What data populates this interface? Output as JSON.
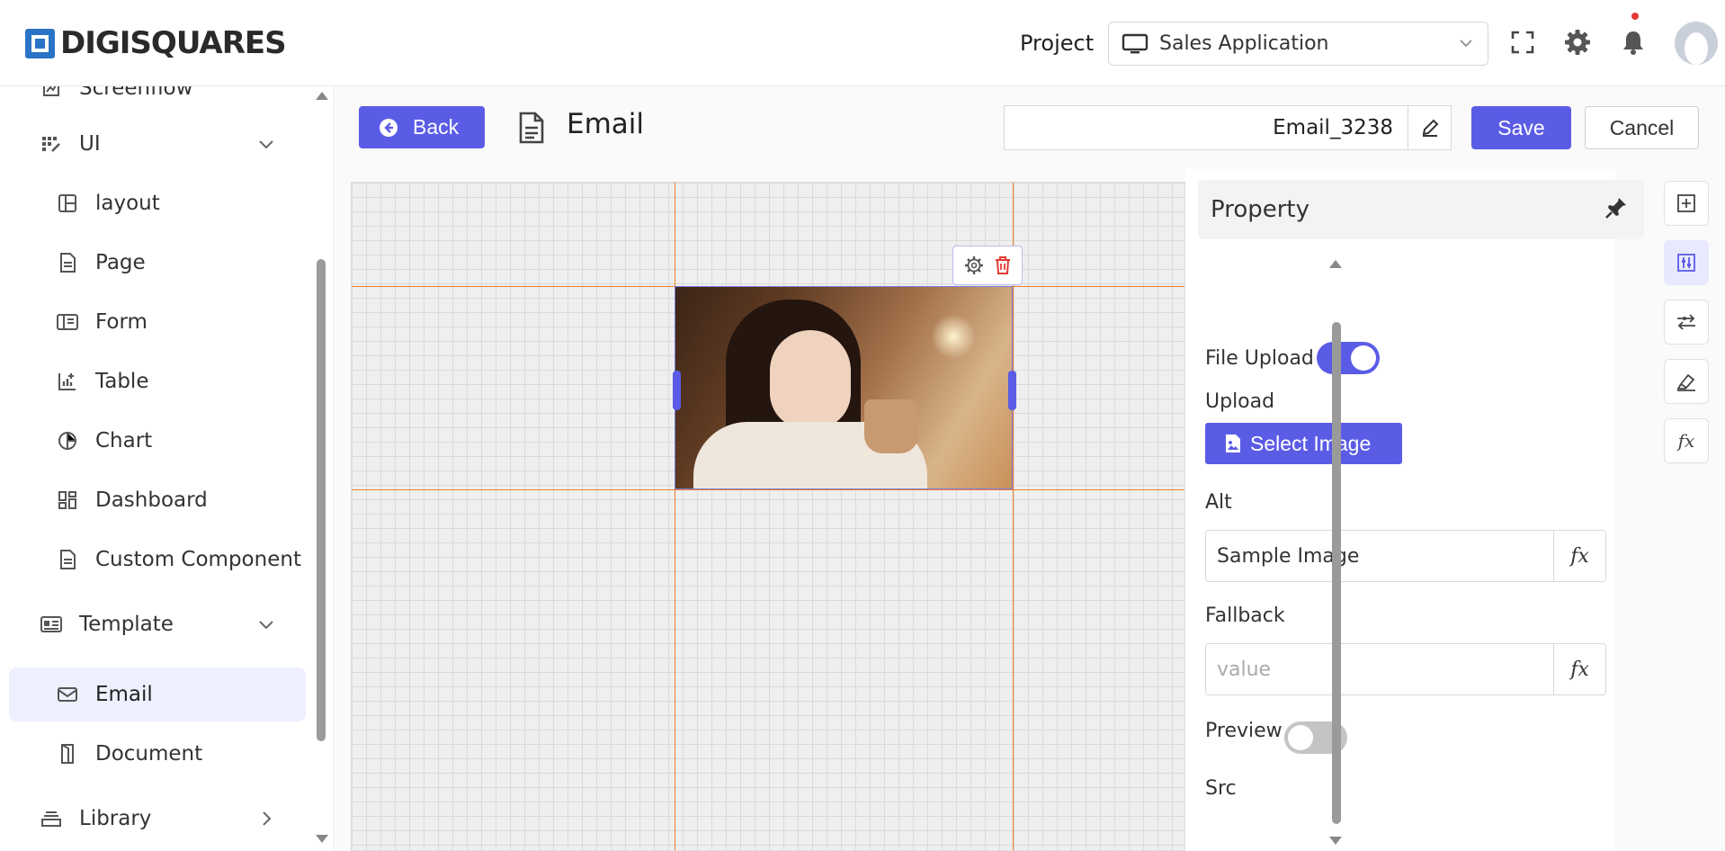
{
  "header": {
    "logo_text": "DIGISQUARES",
    "project_label": "Project",
    "project_value": "Sales Application",
    "icons": [
      "monitor-icon",
      "chevron-down-icon",
      "fullscreen-icon",
      "gear-icon",
      "bell-icon",
      "avatar"
    ]
  },
  "sidebar": {
    "items": [
      {
        "label": "Screenflow",
        "icon": "screenflow-icon",
        "level": 1
      },
      {
        "label": "UI",
        "icon": "ui-icon",
        "level": 1,
        "caret": "down"
      },
      {
        "label": "layout",
        "icon": "layout-icon",
        "level": 2
      },
      {
        "label": "Page",
        "icon": "page-icon",
        "level": 2
      },
      {
        "label": "Form",
        "icon": "form-icon",
        "level": 2
      },
      {
        "label": "Table",
        "icon": "table-icon",
        "level": 2
      },
      {
        "label": "Chart",
        "icon": "chart-icon",
        "level": 2
      },
      {
        "label": "Dashboard",
        "icon": "dashboard-icon",
        "level": 2
      },
      {
        "label": "Custom Component",
        "icon": "custom-component-icon",
        "level": 2
      },
      {
        "label": "Template",
        "icon": "template-icon",
        "level": 1,
        "caret": "down"
      },
      {
        "label": "Email",
        "icon": "mail-icon",
        "level": 2,
        "active": true
      },
      {
        "label": "Document",
        "icon": "document-icon",
        "level": 2
      },
      {
        "label": "Library",
        "icon": "library-icon",
        "level": 1,
        "caret": "right"
      }
    ]
  },
  "toolbar": {
    "back_label": "Back",
    "title": "Email",
    "name_value": "Email_3238",
    "save_label": "Save",
    "cancel_label": "Cancel"
  },
  "canvas": {
    "image_alt": "Sample Image"
  },
  "property_panel": {
    "title": "Property",
    "file_upload_label": "File Upload :",
    "file_upload_on": true,
    "upload_label": "Upload",
    "select_image_label": "Select Image",
    "alt_label": "Alt",
    "alt_value": "Sample Image",
    "fallback_label": "Fallback",
    "fallback_placeholder": "value",
    "preview_label": "Preview :",
    "preview_on": false,
    "src_label": "Src",
    "fx_label": "fx"
  },
  "colors": {
    "accent": "#5b5ce6",
    "guide": "#f07d2a",
    "logo": "#2b73c6",
    "active_bg": "#eef0ff"
  }
}
